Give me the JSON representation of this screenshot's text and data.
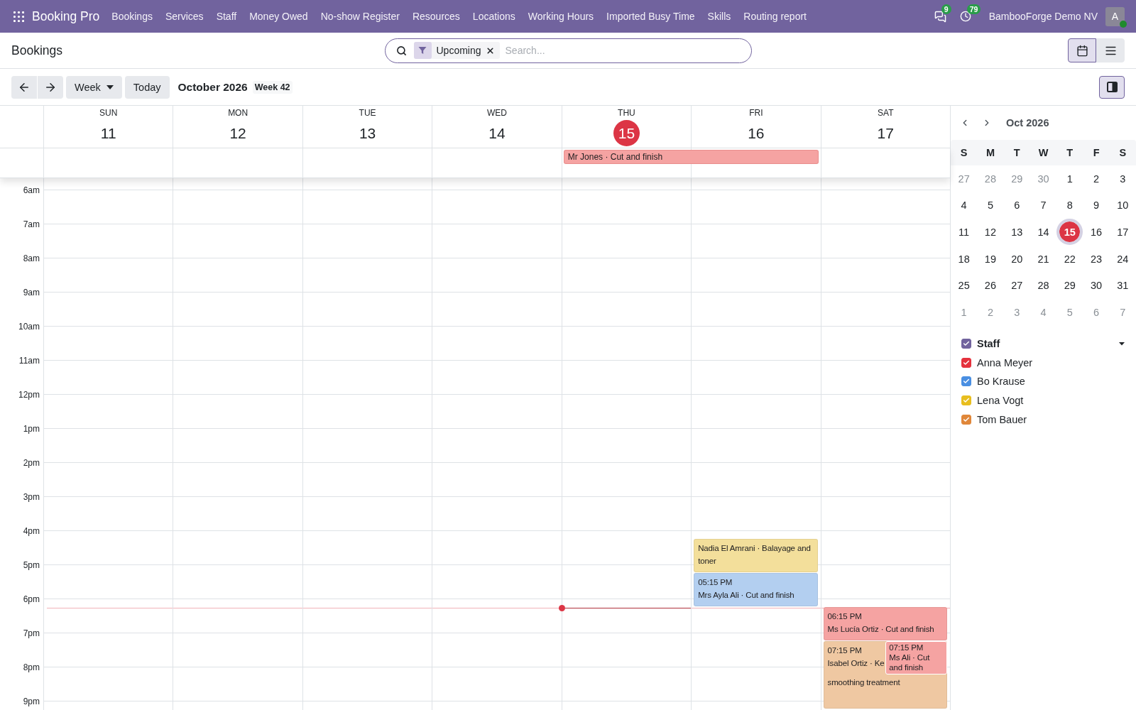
{
  "navbar": {
    "app_name": "Booking Pro",
    "menu": [
      "Bookings",
      "Services",
      "Staff",
      "Money Owed",
      "No-show Register",
      "Resources",
      "Locations",
      "Working Hours",
      "Imported Busy Time",
      "Skills",
      "Routing report"
    ],
    "messages_badge": "9",
    "activities_badge": "79",
    "company": "BambooForge Demo NV",
    "avatar_initial": "A"
  },
  "control_panel": {
    "title": "Bookings",
    "search": {
      "facet": "Upcoming",
      "placeholder": "Search..."
    },
    "views": [
      {
        "kind": "calendar",
        "selected": true
      },
      {
        "kind": "list",
        "selected": false
      }
    ]
  },
  "toolbar": {
    "period": "Week",
    "today": "Today",
    "title": "October 2026",
    "week": "Week 42",
    "sidebar_toggle": {
      "selected": true
    }
  },
  "week": {
    "days": [
      {
        "name": "SUN",
        "number": "11",
        "today": false
      },
      {
        "name": "MON",
        "number": "12",
        "today": false
      },
      {
        "name": "TUE",
        "number": "13",
        "today": false
      },
      {
        "name": "WED",
        "number": "14",
        "today": false
      },
      {
        "name": "THU",
        "number": "15",
        "today": true,
        "all_day": [
          {
            "title": "Mr Jones · Cut and finish",
            "color": "#f5a3a2",
            "spans_next_day": true
          }
        ]
      },
      {
        "name": "FRI",
        "number": "16",
        "today": false,
        "events": [
          {
            "title": "Nadia El Amrani · Balayage and toner",
            "color": "#f3df9b"
          },
          {
            "time": "05:15 PM",
            "title": "Mrs Ayla Ali · Cut and finish",
            "color": "#b3cff0"
          }
        ]
      },
      {
        "name": "SAT",
        "number": "17",
        "today": false,
        "events": [
          {
            "time": "06:15 PM",
            "title": "Ms Lucía Ortiz · Cut and finish",
            "color": "#f5a3a2"
          },
          {
            "time": "07:15 PM",
            "lines": [
              "Isabel Ortiz · Ke",
              "smoothing treatment"
            ],
            "color": "#efc8a2"
          },
          {
            "time": "07:15 PM",
            "title": "Ms Ali · Cut and finish",
            "color": "#f5a3a2"
          }
        ]
      }
    ],
    "hours": [
      "6am",
      "7am",
      "8am",
      "9am",
      "10am",
      "11am",
      "12pm",
      "1pm",
      "2pm",
      "3pm",
      "4pm",
      "5pm",
      "6pm",
      "7pm",
      "8pm",
      "9pm"
    ]
  },
  "sidebar": {
    "month": "Oct 2026",
    "weekdays": [
      "S",
      "M",
      "T",
      "W",
      "T",
      "F",
      "S"
    ],
    "weeks": [
      [
        {
          "label": "27",
          "outside": true,
          "selected": false
        },
        {
          "label": "28",
          "outside": true,
          "selected": false
        },
        {
          "label": "29",
          "outside": true,
          "selected": false
        },
        {
          "label": "30",
          "outside": true,
          "selected": false
        },
        {
          "label": "1",
          "outside": false,
          "selected": false
        },
        {
          "label": "2",
          "outside": false,
          "selected": false
        },
        {
          "label": "3",
          "outside": false,
          "selected": false
        }
      ],
      [
        {
          "label": "4",
          "outside": false,
          "selected": false
        },
        {
          "label": "5",
          "outside": false,
          "selected": false
        },
        {
          "label": "6",
          "outside": false,
          "selected": false
        },
        {
          "label": "7",
          "outside": false,
          "selected": false
        },
        {
          "label": "8",
          "outside": false,
          "selected": false
        },
        {
          "label": "9",
          "outside": false,
          "selected": false
        },
        {
          "label": "10",
          "outside": false,
          "selected": false
        }
      ],
      [
        {
          "label": "11",
          "outside": false,
          "selected": false
        },
        {
          "label": "12",
          "outside": false,
          "selected": false
        },
        {
          "label": "13",
          "outside": false,
          "selected": false
        },
        {
          "label": "14",
          "outside": false,
          "selected": false
        },
        {
          "label": "15",
          "outside": false,
          "selected": true
        },
        {
          "label": "16",
          "outside": false,
          "selected": false
        },
        {
          "label": "17",
          "outside": false,
          "selected": false
        }
      ],
      [
        {
          "label": "18",
          "outside": false,
          "selected": false
        },
        {
          "label": "19",
          "outside": false,
          "selected": false
        },
        {
          "label": "20",
          "outside": false,
          "selected": false
        },
        {
          "label": "21",
          "outside": false,
          "selected": false
        },
        {
          "label": "22",
          "outside": false,
          "selected": false
        },
        {
          "label": "23",
          "outside": false,
          "selected": false
        },
        {
          "label": "24",
          "outside": false,
          "selected": false
        }
      ],
      [
        {
          "label": "25",
          "outside": false,
          "selected": false
        },
        {
          "label": "26",
          "outside": false,
          "selected": false
        },
        {
          "label": "27",
          "outside": false,
          "selected": false
        },
        {
          "label": "28",
          "outside": false,
          "selected": false
        },
        {
          "label": "29",
          "outside": false,
          "selected": false
        },
        {
          "label": "30",
          "outside": false,
          "selected": false
        },
        {
          "label": "31",
          "outside": false,
          "selected": false
        }
      ],
      [
        {
          "label": "1",
          "outside": true,
          "selected": false
        },
        {
          "label": "2",
          "outside": true,
          "selected": false
        },
        {
          "label": "3",
          "outside": true,
          "selected": false
        },
        {
          "label": "4",
          "outside": true,
          "selected": false
        },
        {
          "label": "5",
          "outside": true,
          "selected": false
        },
        {
          "label": "6",
          "outside": true,
          "selected": false
        },
        {
          "label": "7",
          "outside": true,
          "selected": false
        }
      ]
    ],
    "filter": {
      "title": "Staff",
      "checked": true,
      "expanded": true,
      "items": [
        {
          "name": "Anna Meyer",
          "checked": true,
          "color": "#e5323d"
        },
        {
          "name": "Bo Krause",
          "checked": true,
          "color": "#4a8fe2"
        },
        {
          "name": "Lena Vogt",
          "checked": true,
          "color": "#e8be1f"
        },
        {
          "name": "Tom Bauer",
          "checked": true,
          "color": "#e0873a"
        }
      ]
    }
  }
}
